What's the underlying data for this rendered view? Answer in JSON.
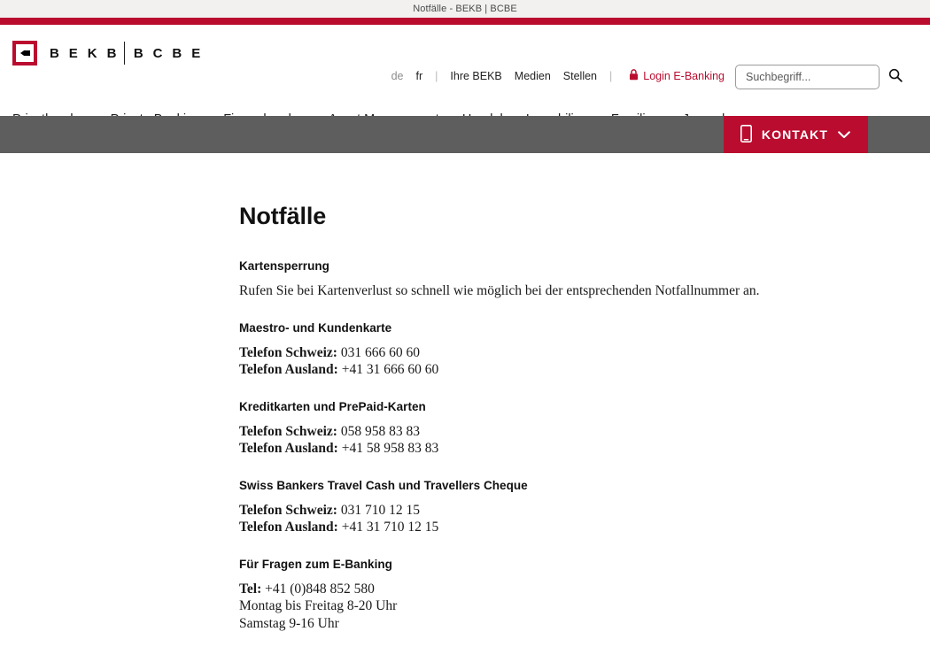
{
  "document_title": "Notfälle - BEKB | BCBE",
  "colors": {
    "brand_red": "#ba0c2f",
    "subbar_grey": "#5e5e5e",
    "titlebar_grey": "#f2f1f0"
  },
  "header": {
    "logo": {
      "text_left": "B E K B",
      "text_right": "B C B E",
      "mark_name": "bekb-chevron-mark"
    },
    "meta_nav": [
      {
        "label": "de",
        "muted": true
      },
      {
        "label": "fr",
        "muted": false
      }
    ],
    "meta_links": [
      {
        "label": "Ihre BEKB"
      },
      {
        "label": "Medien"
      },
      {
        "label": "Stellen"
      }
    ],
    "separator": "|",
    "login": {
      "label": "Login E-Banking",
      "icon": "lock-icon"
    },
    "search": {
      "placeholder": "Suchbegriff...",
      "value": "",
      "icon": "search-icon"
    },
    "main_nav": [
      {
        "label": "Privatkunden"
      },
      {
        "label": "Private Banking"
      },
      {
        "label": "Firmenkunden"
      },
      {
        "label": "Asset Management"
      },
      {
        "label": "Handel"
      },
      {
        "label": "Immobilien"
      },
      {
        "label": "Familien"
      },
      {
        "label": "Jugend"
      }
    ]
  },
  "subbar": {
    "kontakt": {
      "label": "KONTAKT",
      "phone_icon": "mobile-phone-icon",
      "chevron_icon": "chevron-down-icon"
    }
  },
  "main": {
    "page_title": "Notfälle",
    "sections": [
      {
        "title": "Kartensperrung",
        "paragraph": "Rufen Sie bei Kartenverlust so schnell wie möglich bei der entsprechenden Notfallnummer an."
      },
      {
        "title": "Maestro- und Kundenkarte",
        "lines": [
          {
            "label": "Telefon Schweiz:",
            "value": "031 666 60 60"
          },
          {
            "label": "Telefon Ausland:",
            "value": "+41 31 666 60 60"
          }
        ]
      },
      {
        "title": "Kreditkarten und PrePaid-Karten",
        "lines": [
          {
            "label": "Telefon Schweiz:",
            "value": "058 958 83 83"
          },
          {
            "label": "Telefon Ausland:",
            "value": "+41 58 958 83 83"
          }
        ]
      },
      {
        "title": "Swiss Bankers Travel Cash und Travellers Cheque",
        "lines": [
          {
            "label": "Telefon Schweiz:",
            "value": "031 710 12 15"
          },
          {
            "label": "Telefon Ausland:",
            "value": "+41 31 710 12 15"
          }
        ]
      },
      {
        "title": "Für Fragen zum E-Banking",
        "lines": [
          {
            "label": "Tel:",
            "value": "+41 (0)848 852 580"
          }
        ],
        "hours": [
          "Montag bis Freitag 8-20 Uhr",
          "Samstag 9-16 Uhr"
        ]
      }
    ]
  }
}
